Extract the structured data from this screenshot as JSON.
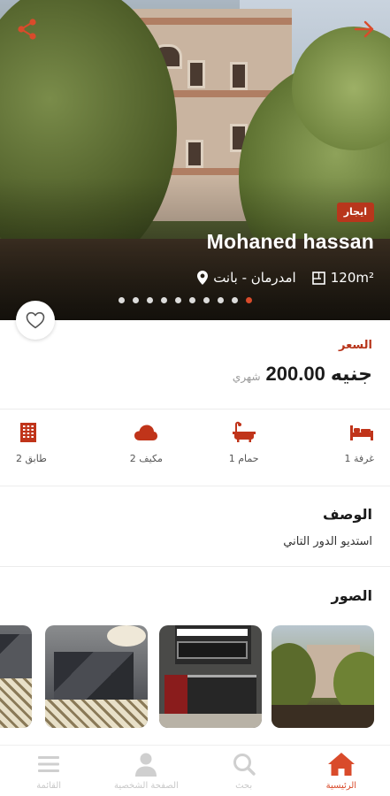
{
  "listing": {
    "badge": "ايجار",
    "owner": "Mohaned hassan",
    "area": "120m²",
    "location": "امدرمان - بانت",
    "image_count": 10,
    "active_image_index": 9
  },
  "price": {
    "label": "السعر",
    "value": "200.00",
    "currency": "جنيه",
    "period": "شهري"
  },
  "features": [
    {
      "label": "1 غرفة",
      "icon": "bed-icon"
    },
    {
      "label": "1 حمام",
      "icon": "bathtub-icon"
    },
    {
      "label": "2 مكيف",
      "icon": "cloud-ac-icon"
    },
    {
      "label": "2 طابق",
      "icon": "building-icon"
    }
  ],
  "description": {
    "title": "الوصف",
    "text": "استديو الدور التاني"
  },
  "photos": {
    "title": "الصور"
  },
  "nav": [
    {
      "label": "الرئيسية",
      "icon": "home-icon",
      "active": true
    },
    {
      "label": "بحث",
      "icon": "search-icon",
      "active": false
    },
    {
      "label": "الصفحة الشخصية",
      "icon": "person-icon",
      "active": false
    },
    {
      "label": "القائمة",
      "icon": "menu-icon",
      "active": false
    }
  ],
  "colors": {
    "accent": "#d94b2b",
    "badge": "#b8361c",
    "feature_icon": "#c0341a"
  }
}
